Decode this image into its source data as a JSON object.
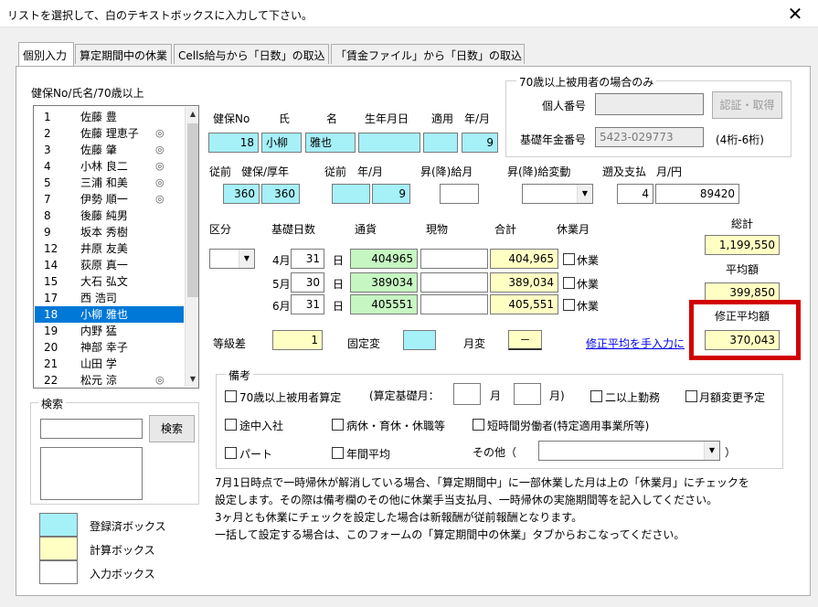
{
  "window": {
    "title": "リストを選択して、白のテキストボックスに入力して下さい。",
    "close_glyph": "✕"
  },
  "tabs": [
    {
      "label": "個別入力"
    },
    {
      "label": "算定期間中の休業"
    },
    {
      "label": "Cells給与から「日数」の取込"
    },
    {
      "label": "「賃金ファイル」から「日数」の取込"
    }
  ],
  "list": {
    "header": "健保No/氏名/70歳以上",
    "items": [
      {
        "no": "1",
        "name": "佐藤 豊",
        "mark": ""
      },
      {
        "no": "2",
        "name": "佐藤 理恵子",
        "mark": "◎"
      },
      {
        "no": "3",
        "name": "佐藤 肇",
        "mark": "◎"
      },
      {
        "no": "4",
        "name": "小林 良二",
        "mark": "◎"
      },
      {
        "no": "5",
        "name": "三浦 和美",
        "mark": "◎"
      },
      {
        "no": "7",
        "name": "伊勢 順一",
        "mark": "◎"
      },
      {
        "no": "8",
        "name": "後藤 純男",
        "mark": ""
      },
      {
        "no": "9",
        "name": "坂本 秀樹",
        "mark": ""
      },
      {
        "no": "12",
        "name": "井原 友美",
        "mark": ""
      },
      {
        "no": "14",
        "name": "荻原 真一",
        "mark": ""
      },
      {
        "no": "15",
        "name": "大石 弘文",
        "mark": ""
      },
      {
        "no": "17",
        "name": "西 浩司",
        "mark": ""
      },
      {
        "no": "18",
        "name": "小柳 雅也",
        "mark": ""
      },
      {
        "no": "19",
        "name": "内野 猛",
        "mark": ""
      },
      {
        "no": "20",
        "name": "神部 幸子",
        "mark": ""
      },
      {
        "no": "21",
        "name": "山田 学",
        "mark": ""
      },
      {
        "no": "22",
        "name": "松元 涼",
        "mark": "◎"
      }
    ],
    "selected_index": 12,
    "scroll_up": "▲",
    "scroll_down": "▼"
  },
  "search": {
    "legend": "検索",
    "button": "検索",
    "value": ""
  },
  "legend_boxes": {
    "registered": "登録済ボックス",
    "calculated": "計算ボックス",
    "input": "入力ボックス"
  },
  "row1": {
    "labels": {
      "kenpo_no": "健保No",
      "shi": "氏",
      "mei": "名",
      "birth": "生年月日",
      "apply": "適用",
      "month": "年/月"
    },
    "values": {
      "kenpo_no": "18",
      "shi": "小柳",
      "mei": "雅也",
      "birth": "",
      "apply": "",
      "month": "9"
    }
  },
  "row2": {
    "labels": {
      "before": "従前",
      "kenpo": "健保/厚年",
      "before2": "従前",
      "ym": "年/月",
      "raise_salary": "昇(降)給月",
      "raise_change": "昇(降)給変動",
      "retro": "遡及支払",
      "retro_ym": "月/円"
    },
    "values": {
      "kenpo": "360",
      "kosei": "360",
      "before_y": "",
      "before_m": "9",
      "raise_salary": "",
      "raise_change": "",
      "retro_m": "4",
      "retro_amount": "89420"
    }
  },
  "senior": {
    "legend": "70歳以上被用者の場合のみ",
    "personal_no_label": "個人番号",
    "personal_no": "",
    "auth_button": "認証・取得",
    "pension_label": "基礎年金番号",
    "pension_no": "5423-029773",
    "pension_hint": "(4桁-6桁)"
  },
  "months": {
    "headers": {
      "kubun": "区分",
      "days": "基礎日数",
      "currency": "通貨",
      "kind": "現物",
      "total": "合計",
      "leave": "休業月"
    },
    "kubun_value": "",
    "day_unit": "日",
    "month_suffix": "月",
    "leave_label": "休業",
    "rows": [
      {
        "month": "4",
        "days": "31",
        "currency": "404965",
        "kind": "",
        "total": "404,965"
      },
      {
        "month": "5",
        "days": "30",
        "currency": "389034",
        "kind": "",
        "total": "389,034"
      },
      {
        "month": "6",
        "days": "31",
        "currency": "405551",
        "kind": "",
        "total": "405,551"
      }
    ]
  },
  "summary": {
    "grand_total_label": "総計",
    "grand_total": "1,199,550",
    "avg_label": "平均額",
    "avg": "399,850",
    "mod_avg_label": "修正平均額",
    "mod_avg": "370,043",
    "manual_link": "修正平均を手入力に"
  },
  "grade": {
    "diff_label": "等級差",
    "diff": "1",
    "fixed_label": "固定変",
    "fixed": "",
    "monthly_label": "月変",
    "monthly": "－"
  },
  "remarks": {
    "legend": "備考",
    "over70": "70歳以上被用者算定",
    "base_month_label": "(算定基礎月：",
    "base_month_1": "",
    "month_unit": "月",
    "base_month_2": "",
    "month_close": "月)",
    "multi_work": "二以上勤務",
    "monthly_change_plan": "月額変更予定",
    "mid_join": "途中入社",
    "sick_leave": "病休・育休・休職等",
    "short_time": "短時間労働者(特定適用事業所等)",
    "part": "パート",
    "annual_avg": "年間平均",
    "other_label": "その他（",
    "other_value": "",
    "other_close": "）"
  },
  "notes": [
    "7月1日時点で一時帰休が解消している場合、「算定期間中」に一部休業した月は上の「休業月」にチェックを",
    "設定します。その際は備考欄のその他に休業手当支払月、一時帰休の実施期間等を記入してください。",
    "3ヶ月とも休業にチェックを設定した場合は新報酬が従前報酬となります。",
    "一括して設定する場合は、このフォームの「算定期間中の休業」タブからおこなってください。"
  ],
  "colors": {
    "registered": "#a6f0f8",
    "calculated": "#ffffc4",
    "currency": "#c6f6c2",
    "highlight": "#d10000",
    "selected": "#0078d7"
  }
}
